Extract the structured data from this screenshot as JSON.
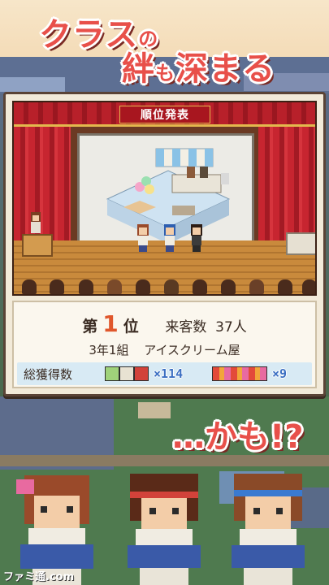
{
  "catchphrase": {
    "line1_a": "クラス",
    "line1_b": "の",
    "line2_a": "絆",
    "line2_b": "も",
    "line2_c": "深まる",
    "line3": "…かも!?"
  },
  "stage": {
    "banner": "順位発表"
  },
  "result": {
    "rank_prefix": "第",
    "rank_number": "1",
    "rank_suffix": "位",
    "visitors_label": "来客数",
    "visitors_value": "37人",
    "class_name": "3年1組",
    "shop_name": "アイスクリーム屋",
    "score_label": "総獲得数",
    "score_items": [
      {
        "icon": "tool-items-icon",
        "multiplier": "×114"
      },
      {
        "icon": "bouquet-icon",
        "multiplier": "×9"
      }
    ]
  },
  "watermark": "ファミ通.com",
  "colors": {
    "catch_red": "#e8504a",
    "curtain_red": "#b8202a",
    "rank_orange": "#e0572c",
    "multiplier_blue": "#3b6fc2",
    "score_row_bg": "#d8eaf4"
  }
}
